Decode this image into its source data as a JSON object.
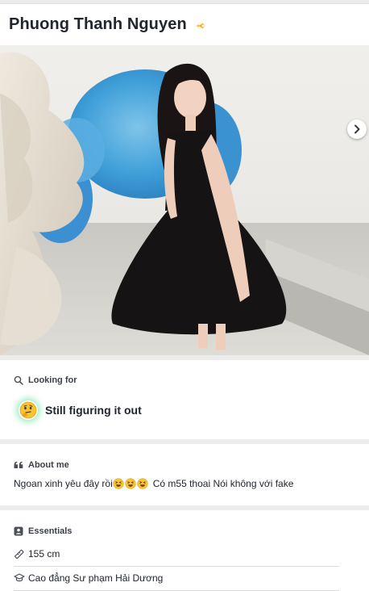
{
  "profile": {
    "name": "Phuong Thanh Nguyen",
    "verified_icon": "verified-badge-icon"
  },
  "photo": {
    "description_icon": "profile-photo",
    "next_icon": "chevron-right-icon"
  },
  "looking_for": {
    "heading": "Looking for",
    "icon": "search-icon",
    "value": "Still figuring it out",
    "value_emoji": "thinking-face-icon"
  },
  "about_me": {
    "heading": "About me",
    "icon": "quote-icon",
    "text_before": "Ngoan xinh yêu đây rồi",
    "emojis": [
      "grinning-squint-face-icon",
      "grinning-squint-face-icon",
      "grinning-squint-face-icon"
    ],
    "text_after": "Có m55 thoai Nói không với fake"
  },
  "essentials": {
    "heading": "Essentials",
    "icon": "id-card-icon",
    "items": [
      {
        "icon": "ruler-icon",
        "label": "155 cm"
      },
      {
        "icon": "graduation-cap-icon",
        "label": "Cao đẳng Sư phạm Hải Dương"
      }
    ]
  },
  "colors": {
    "text": "#21262e",
    "accent_gold": "#f3b62a",
    "card_bg": "#ffffff",
    "page_bg": "#ececec"
  }
}
